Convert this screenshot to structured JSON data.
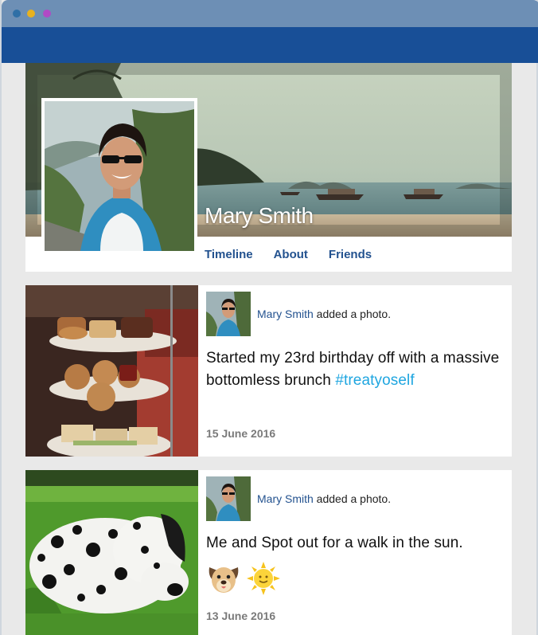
{
  "window": {
    "controls": [
      "close",
      "minimize",
      "maximize"
    ]
  },
  "profile": {
    "name": "Mary Smith",
    "nav": [
      "Timeline",
      "About",
      "Friends"
    ]
  },
  "posts": [
    {
      "author": "Mary Smith",
      "action": " added a photo.",
      "text": "Started my 23rd birthday off with a massive bottomless brunch ",
      "hashtag": "#treatyoself",
      "date": "15 June 2016",
      "photo": "afternoon-tea-stand-photo"
    },
    {
      "author": "Mary Smith",
      "action": " added a photo.",
      "text": "Me and Spot out for a walk in the sun.",
      "emojis": [
        "dog-face-emoji",
        "sun-emoji"
      ],
      "date": "13 June 2016",
      "photo": "dalmatian-on-grass-photo"
    }
  ],
  "colors": {
    "titlebar": "#6d8fb5",
    "navbar": "#184f97",
    "link": "#23528f",
    "hashtag": "#1fa6e0"
  }
}
